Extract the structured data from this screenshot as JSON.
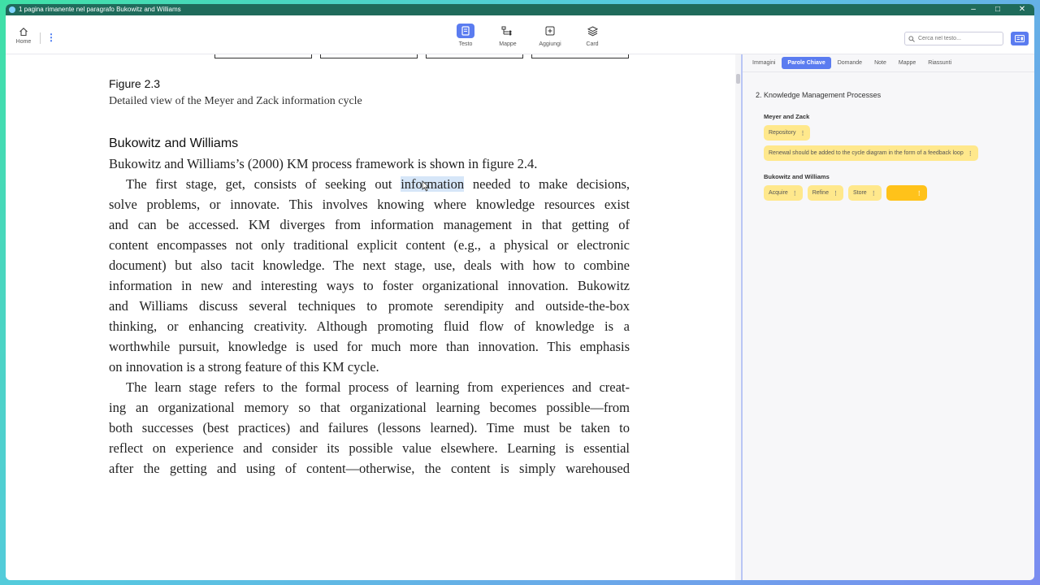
{
  "window": {
    "title": "1 pagina rimanente nel paragrafo Bukowitz and Williams"
  },
  "toolbar": {
    "home_label": "Home",
    "tools": [
      {
        "label": "Testo",
        "icon": "document-icon",
        "active": true
      },
      {
        "label": "Mappe",
        "icon": "map-tree-icon",
        "active": false
      },
      {
        "label": "Aggiungi",
        "icon": "add-square-icon",
        "active": false
      },
      {
        "label": "Card",
        "icon": "cards-stack-icon",
        "active": false
      }
    ],
    "search_placeholder": "Cerca nel testo..."
  },
  "content": {
    "figure_title": "Figure 2.3",
    "figure_caption": "Detailed view of the Meyer and Zack information cycle",
    "section_heading": "Bukowitz and Williams",
    "lines": [
      "Bukowitz and Williams’s (2000) KM process framework is shown in figure 2.4.",
      "solve problems, or innovate. This involves knowing where knowledge resources exist",
      "and can be accessed. KM diverges from information management in that getting of",
      "content encompasses not only traditional explicit content (e.g., a physical or electronic",
      "document) but also tacit knowledge. The next stage, use, deals with how to combine",
      "information in new and interesting ways to foster organizational innovation. Bukowitz",
      "and Williams discuss several techniques to promote serendipity and outside-the-box",
      "thinking, or enhancing creativity. Although promoting fluid flow of knowledge is a",
      "worthwhile pursuit, knowledge is used for much more than innovation. This emphasis",
      "on innovation is a strong feature of this KM cycle.",
      "ing an organizational memory so that organizational learning becomes possible—from",
      "both successes (best practices) and failures (lessons learned). Time must be taken to",
      "reflect on experience and consider its possible value elsewhere. Learning is essential",
      "after the getting and using of content—otherwise, the content is simply warehoused"
    ],
    "para1_line1_before": "The first stage, get, consists of seeking out",
    "para1_line1_highlight": "information",
    "para1_line1_after": "needed to make decisions,",
    "para2_line1": "The learn stage refers to the formal process of learning from experiences and creat-"
  },
  "panel": {
    "tabs": [
      "Immagini",
      "Parole Chiave",
      "Domande",
      "Note",
      "Mappe",
      "Riassunti"
    ],
    "active_tab": "Parole Chiave",
    "section_title": "2. Knowledge Management Processes",
    "groups": [
      {
        "title": "Meyer and Zack",
        "keywords": [
          "Repository",
          "Renewal should be added to the cycle diagram in the form of a feedback loop"
        ]
      },
      {
        "title": "Bukowitz and Williams",
        "keywords": [
          "Acquire",
          "Refine",
          "Store",
          ""
        ]
      }
    ]
  },
  "colors": {
    "accent": "#5b7cf0",
    "chip": "#ffe88c",
    "chip_selected": "#ffc21a",
    "highlight": "#d6e6f8"
  }
}
